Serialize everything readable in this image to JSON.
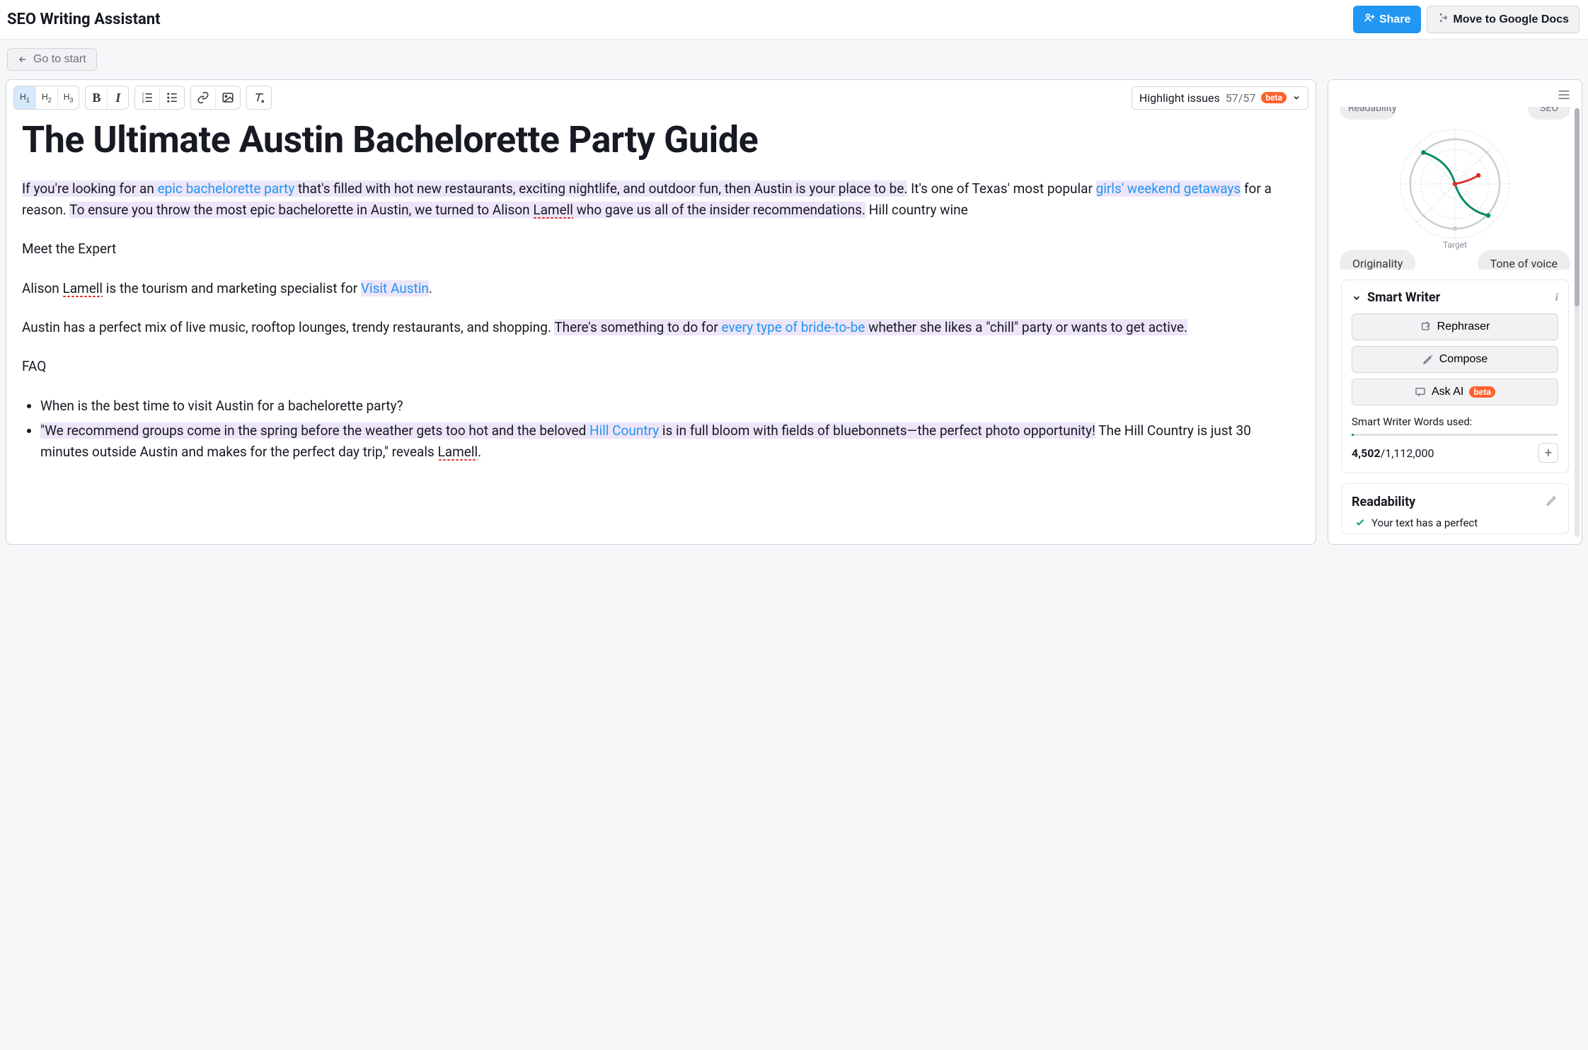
{
  "header": {
    "title": "SEO Writing Assistant",
    "share": "Share",
    "move": "Move to Google Docs",
    "goToStart": "Go to start"
  },
  "toolbar": {
    "h1": "H1",
    "h2": "H2",
    "h3": "H3",
    "highlightIssues": "Highlight issues",
    "issuesCount": "57/57",
    "beta": "beta"
  },
  "doc": {
    "title": "The Ultimate Austin Bachelorette Party Guide",
    "p1_seg1": "If you're looking for an ",
    "p1_link1": "epic bachelorette party",
    "p1_seg2": " that's filled with hot new restaurants, exciting nightlife, and outdoor fun, then Austin is your place to be.",
    "p1_seg3": " It's one of Texas' most popular ",
    "p1_link2": "girls' weekend getaways",
    "p1_seg4": " for a reason. ",
    "p1_seg5_a": "To ensure you throw the most epic bachelorette in Austin, we turned to Alison ",
    "p1_lamell1": "Lamell",
    "p1_seg5_b": " who gave us all of the insider recommendations.",
    "p1_seg6": " Hill country wine",
    "p2": "Meet the Expert",
    "p3_a": "Alison ",
    "p3_lamell": "Lamell",
    "p3_b": " is the tourism and marketing specialist for ",
    "p3_link": "Visit Austin",
    "p3_c": ".",
    "p4_a": "Austin has a perfect mix of live music, rooftop lounges, trendy restaurants, and shopping. ",
    "p4_hl1": "There's something to do for ",
    "p4_link": "every type of bride-to-be",
    "p4_hl2": " whether she likes a \"chill\" party or wants to get active.",
    "faqHeading": "FAQ",
    "faq1": "When is the best time to visit Austin for a bachelorette party?",
    "faq2_hl_a": "\"We recommend groups come in the spring before the weather gets too hot and the beloved ",
    "faq2_link": "Hill Country",
    "faq2_hl_b": " is in full bloom with fields of bluebonnets—the perfect photo opportunity!",
    "faq2_c": " The Hill Country is just 30 minutes outside Austin and makes for the perfect day trip,\" reveals ",
    "faq2_lamell": "Lamell",
    "faq2_d": "."
  },
  "radar": {
    "topLeft": "Readability",
    "topRight": "SEO",
    "target": "Target",
    "originality": "Originality",
    "tone": "Tone of voice"
  },
  "smartWriter": {
    "title": "Smart Writer",
    "rephraser": "Rephraser",
    "compose": "Compose",
    "askAI": "Ask AI",
    "beta": "beta",
    "wordsLabel": "Smart Writer Words used:",
    "used": "4,502",
    "total": "/1,112,000"
  },
  "readability": {
    "title": "Readability",
    "line1": "Your text has a perfect"
  }
}
